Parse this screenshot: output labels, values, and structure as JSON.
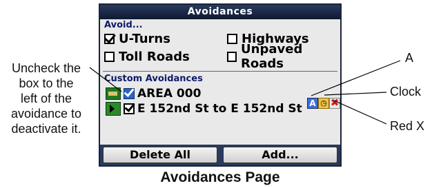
{
  "screen": {
    "title": "Avoidances",
    "avoid_label": "Avoid...",
    "options": [
      {
        "label": "U-Turns",
        "checked": true
      },
      {
        "label": "Highways",
        "checked": false
      },
      {
        "label": "Toll Roads",
        "checked": false
      },
      {
        "label": "Unpaved Roads",
        "checked": false
      }
    ],
    "custom_label": "Custom Avoidances",
    "custom_items": [
      {
        "name": "AREA 000",
        "icon": "area-icon",
        "checked": true
      },
      {
        "name": "E 152nd St to E 152nd St",
        "icon": "route-icon",
        "checked": true
      }
    ],
    "tools": {
      "a": "A",
      "clock": "◷",
      "x": "✖"
    },
    "buttons": {
      "delete_all": "Delete All",
      "add": "Add..."
    }
  },
  "annotations": {
    "uncheck_note": [
      "Uncheck the",
      "box to the",
      "left of the",
      "avoidance to",
      "deactivate it."
    ],
    "a_label": "A",
    "clock_label": "Clock",
    "redx_label": "Red X"
  },
  "caption": "Avoidances Page",
  "colors": {
    "title_bar": "#0e1a33",
    "section_text": "#0e1a6a",
    "screen_bg": "#e9e9e9",
    "red_x": "#d01818"
  }
}
